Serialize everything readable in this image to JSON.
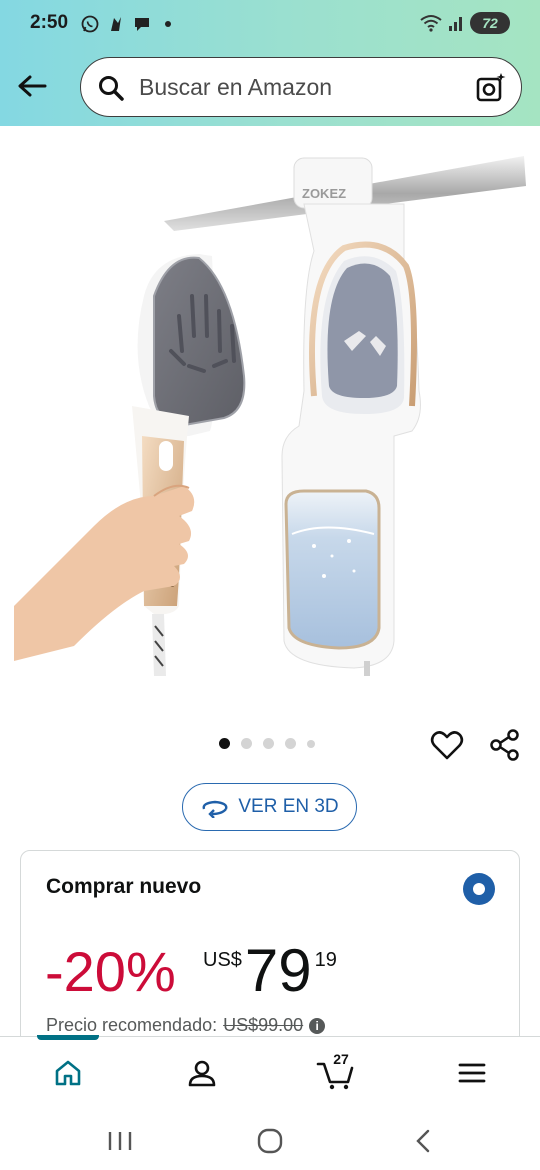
{
  "status_bar": {
    "time": "2:50",
    "battery": "72"
  },
  "search": {
    "placeholder": "Buscar en Amazon"
  },
  "product": {
    "brand_on_image": "ZOKEZ",
    "carousel_dots": 5,
    "carousel_active": 0
  },
  "actions": {
    "view3d_label": "VER EN 3D"
  },
  "buy_box": {
    "title": "Comprar nuevo",
    "discount": "-20%",
    "currency": "US$",
    "price_whole": "79",
    "price_fraction": "19",
    "list_label": "Precio recomendado:",
    "list_price": "US$99.00"
  },
  "bottom_nav": {
    "cart_count": "27"
  },
  "colors": {
    "header_gradient_start": "#84d8e2",
    "header_gradient_end": "#a5e4c2",
    "accent_blue": "#1f5fa8",
    "discount_red": "#cc0c39",
    "teal": "#007185"
  }
}
